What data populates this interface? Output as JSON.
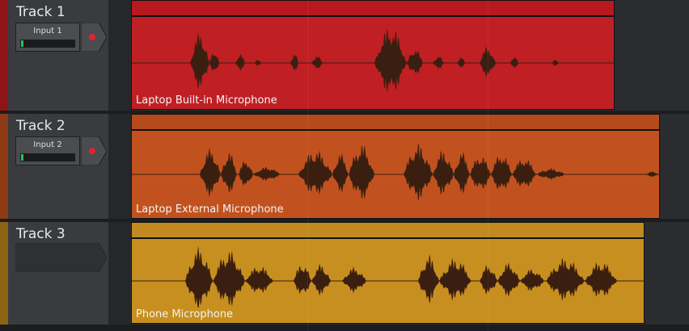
{
  "tracks": [
    {
      "name": "Track 1",
      "input_label": "Input 1",
      "clip_label": "Laptop Built-in Microphone",
      "color": "#c01f24",
      "color_dark": "#8e1418",
      "bar_color": "#b8181e",
      "has_input": true
    },
    {
      "name": "Track 2",
      "input_label": "Input 2",
      "clip_label": "Laptop External Microphone",
      "color": "#c1521f",
      "color_dark": "#8f3a14",
      "bar_color": "#b54b1c",
      "has_input": true
    },
    {
      "name": "Track 3",
      "input_label": "",
      "clip_label": "Phone Microphone",
      "color": "#c78f20",
      "color_dark": "#8e6414",
      "bar_color": "#c08a1e",
      "has_input": false
    }
  ],
  "colors": {
    "record_dot": "#e0242e",
    "waveform": "#3a1f10",
    "track_header": "#393b3f",
    "lane_bg": "#2b2c2f"
  }
}
